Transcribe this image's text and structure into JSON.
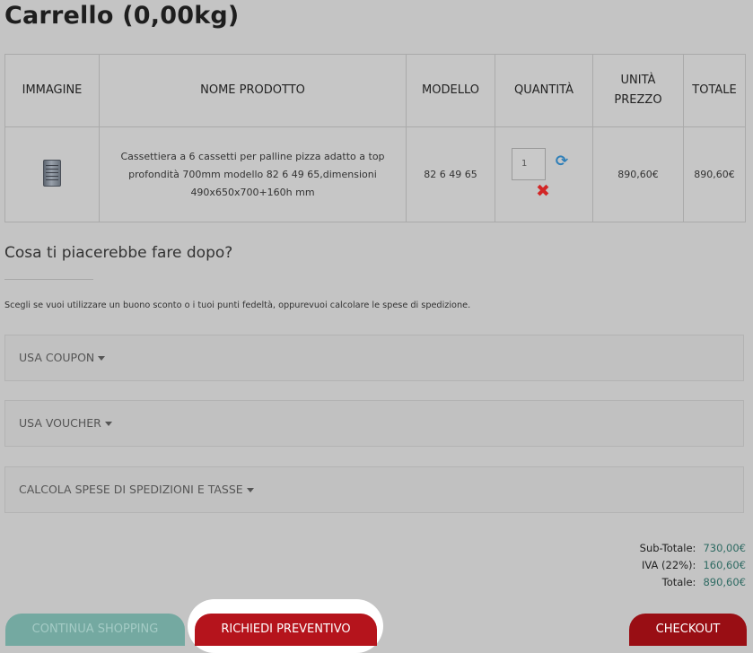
{
  "page_title": "Carrello  (0,00kg)",
  "cart_table": {
    "headers": {
      "image": "IMMAGINE",
      "product_name": "NOME PRODOTTO",
      "model": "MODELLO",
      "quantity": "QUANTITÀ",
      "unit_price_line1": "UNITÀ",
      "unit_price_line2": "PREZZO",
      "total": "TOTALE"
    },
    "rows": [
      {
        "image_icon": "product-thumbnail",
        "product_name": "Cassettiera a 6 cassetti per palline pizza adatto a top profondità 700mm modello 82 6 49 65,dimensioni 490x650x700+160h mm",
        "model": "82 6 49 65",
        "quantity": "1",
        "unit_price": "890,60€",
        "total": "890,60€",
        "update_icon": "refresh-icon",
        "remove_icon": "remove-icon"
      }
    ]
  },
  "next_steps": {
    "heading": "Cosa ti piacerebbe fare dopo?",
    "description": "Scegli se vuoi utilizzare un buono sconto o i tuoi punti fedeltà, oppurevuoi calcolare le spese di spedizione.",
    "panels": {
      "coupon": "USA COUPON",
      "voucher": "USA VOUCHER",
      "shipping": "CALCOLA SPESE DI SPEDIZIONI E TASSE"
    }
  },
  "totals": {
    "subtotal_label": "Sub-Totale:",
    "subtotal_value": "730,00€",
    "vat_label": "IVA (22%):",
    "vat_value": "160,60€",
    "total_label": "Totale:",
    "total_value": "890,60€"
  },
  "buttons": {
    "continue_shopping": "CONTINUA SHOPPING",
    "request_quote": "RICHIEDI PREVENTIVO",
    "checkout": "CHECKOUT"
  },
  "colors": {
    "background": "#c4c4c4",
    "continue_button": "#74a9a1",
    "quote_button": "#b5141c",
    "checkout_button": "#990e14",
    "price_accent": "#2d6a62"
  }
}
